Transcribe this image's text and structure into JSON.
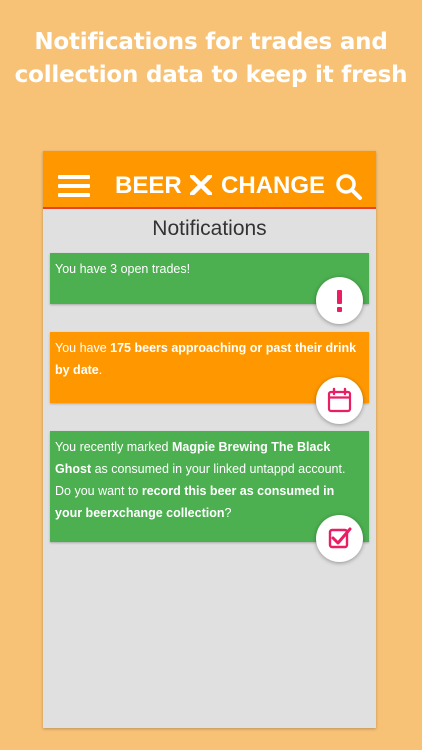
{
  "promo": {
    "line1": "Notifications for trades and",
    "line2": "collection data to keep it fresh"
  },
  "appbar": {
    "logo_left": "BEER",
    "logo_right": "CHANGE",
    "menu_icon": "hamburger-menu-icon",
    "search_icon": "search-icon"
  },
  "page": {
    "title": "Notifications"
  },
  "notifications": [
    {
      "text": "You have 3 open trades!",
      "icon": "exclamation-icon",
      "color": "#4caf50"
    },
    {
      "prefix": "You have ",
      "bold": "175 beers approaching or past their drink by date",
      "suffix": ".",
      "icon": "calendar-icon",
      "color": "#ff9800"
    },
    {
      "p1": "You recently marked ",
      "b1": "Magpie Brewing The Black Ghost",
      "p2": " as consumed in your linked untappd account. Do you want to ",
      "b2": "record this beer as consumed in your beerxchange collection",
      "p3": "?",
      "icon": "checkbox-icon",
      "color": "#4caf50"
    }
  ],
  "colors": {
    "background": "#f8c276",
    "accent": "#ff9800",
    "green": "#4caf50",
    "icon_pink": "#e91e63"
  }
}
